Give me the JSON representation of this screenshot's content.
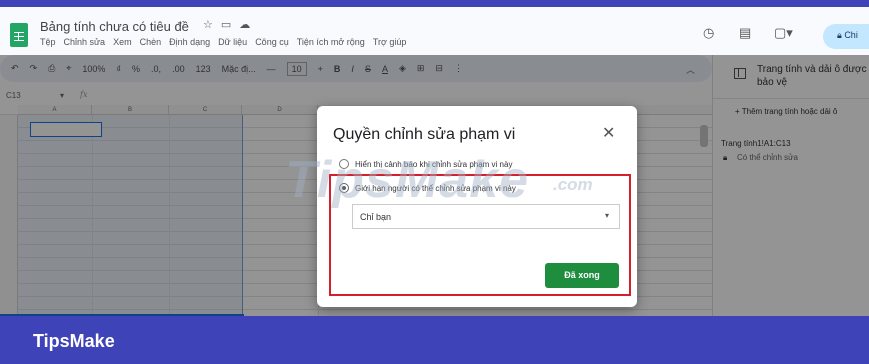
{
  "header": {
    "doc_title": "Bảng tính chưa có tiêu đề",
    "title_icons": [
      "star-icon",
      "folder-icon",
      "cloud-icon"
    ],
    "menu": [
      "Tệp",
      "Chỉnh sửa",
      "Xem",
      "Chèn",
      "Định dạng",
      "Dữ liệu",
      "Công cụ",
      "Tiện ích mở rộng",
      "Trợ giúp"
    ],
    "right_icons": [
      "history-icon",
      "comment-icon",
      "meet-icon"
    ],
    "share_label": "Chi"
  },
  "toolbar": {
    "zoom": "100%",
    "currency": "₫",
    "percent": "%",
    "decrease_decimal": ".0,",
    "increase_decimal": ".00",
    "number_format": "123",
    "font": "Mặc đị...",
    "font_size": "10",
    "bold": "B",
    "italic": "I",
    "strike": "S",
    "text_color": "A"
  },
  "formula_bar": {
    "name_box": "C13",
    "fx": "fx"
  },
  "grid": {
    "columns": [
      "A",
      "B",
      "C",
      "D"
    ]
  },
  "side_panel": {
    "title": "Trang tính và dải ô được bảo vệ",
    "add_link": "+ Thêm trang tính hoặc dải ô",
    "range": "Trang tính1!A1:C13",
    "permission": "Có thể chỉnh sửa"
  },
  "dialog": {
    "title": "Quyền chỉnh sửa phạm vi",
    "option_warning": "Hiển thị cảnh báo khi chỉnh sửa phạm vi này",
    "option_restrict": "Giới hạn người có thể chỉnh sửa phạm vi này",
    "select_value": "Chỉ bạn",
    "done_label": "Đã xong",
    "selected_option": "restrict"
  },
  "watermark": {
    "text": "TipsMake",
    "suffix": ".com"
  },
  "brand": "TipsMake",
  "colors": {
    "brand_bar": "#3f43b8",
    "done_button": "#1e8e3e",
    "highlight_box": "#d61f2c",
    "share_button": "#c2e7ff"
  }
}
